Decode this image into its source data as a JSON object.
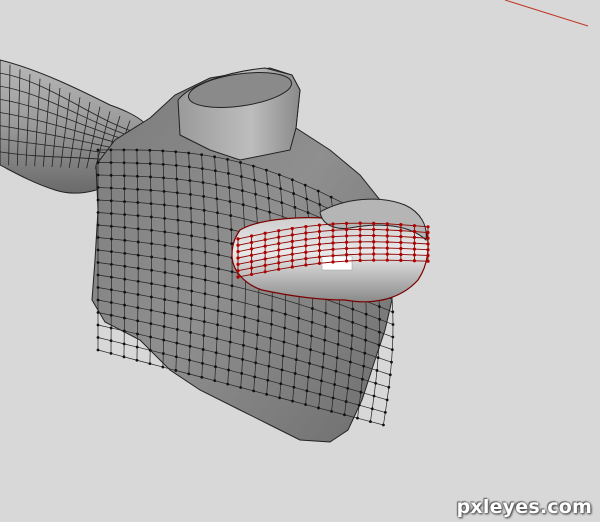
{
  "viewport": {
    "background": "#d8d8d8",
    "mesh_fill": "#8e8e8e",
    "mesh_light": "#b4b4b4",
    "mesh_dark": "#5e5e5e",
    "wire_color": "#1a1a1a",
    "selection_color": "#b00000",
    "axis_color": "#c0392b"
  },
  "watermark": {
    "text": "pxleyes.com"
  }
}
